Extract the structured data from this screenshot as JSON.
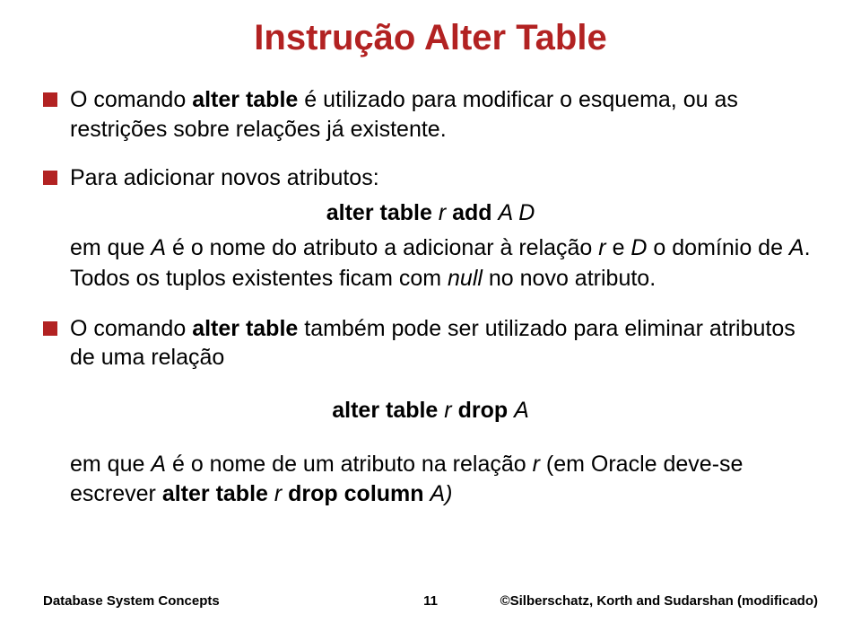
{
  "title": "Instrução Alter Table",
  "bullets": [
    {
      "main": "O comando <b>alter table</b> é utilizado para modificar o esquema, ou as restrições sobre relações já existente."
    },
    {
      "main": "Para adicionar novos atributos:",
      "sub_center": "<b>alter table</b> <i>r</i> <b>add</b> <i>A D</i>",
      "sub": "em que <i>A</i> é o nome do atributo a adicionar à relação <i>r</i>  e <i>D</i> o domínio de <i>A</i>. Todos os tuplos existentes ficam com <i>null</i> no novo atributo."
    },
    {
      "main": "O comando <b>alter table</b> também pode ser utilizado para eliminar atributos de uma relação",
      "sub_center_spaced": "<b>alter table</b> <i>r</i> <b>drop</b> <i>A</i>",
      "sub": "em que <i>A</i> é o nome de um atributo na relação <i>r</i> (em Oracle deve-se escrever <b>alter table</b> <i>r</i> <b>drop column</b> <i>A)</i>"
    }
  ],
  "footer": {
    "left": "Database System Concepts",
    "center": "11",
    "right": "©Silberschatz, Korth and Sudarshan (modificado)"
  }
}
